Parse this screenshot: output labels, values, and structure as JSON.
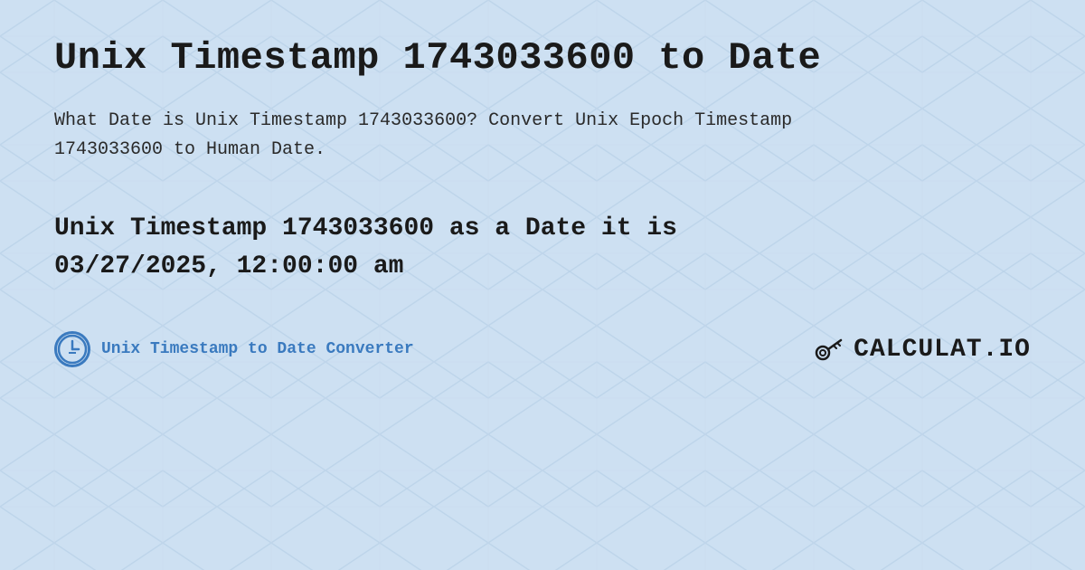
{
  "page": {
    "title": "Unix Timestamp 1743033600 to Date",
    "description": "What Date is Unix Timestamp 1743033600? Convert Unix Epoch Timestamp 1743033600 to Human Date.",
    "result_line1": "Unix Timestamp 1743033600 as a Date it is",
    "result_line2": "03/27/2025, 12:00:00 am",
    "footer_label": "Unix Timestamp to Date Converter",
    "logo_text": "CALCULAT.IO",
    "background_color": "#d6e8f7",
    "accent_color": "#3a7abf"
  }
}
